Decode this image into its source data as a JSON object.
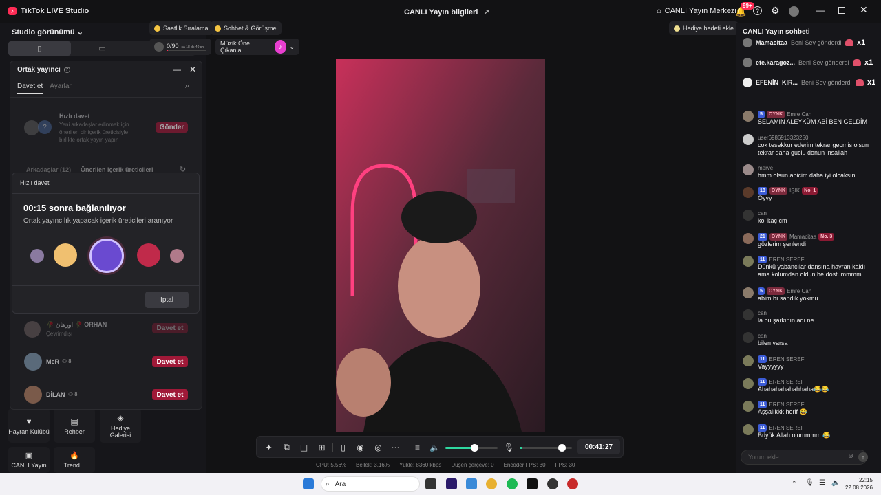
{
  "titlebar": {
    "app_name": "TikTok LIVE Studio",
    "center_title": "CANLI Yayın bilgileri",
    "live_center": "CANLI Yayın Merkezi",
    "notif_badge": "99+"
  },
  "left": {
    "studio_view": "Studio görünümü",
    "chips": {
      "hourly_rank": "Saatlik Sıralama",
      "chat_call": "Sohbet & Görüşme",
      "progress": "0/90",
      "progress_sub": "sa 18 dk 40 sn",
      "music": "Müzik Öne Çıkanla...",
      "gift_goal": "Hediye hedefi ekle"
    },
    "cohost": {
      "title": "Ortak yayıncı",
      "tab_invite": "Davet et",
      "tab_settings": "Ayarlar",
      "quick_invite_title": "Hızlı davet",
      "quick_invite_desc": "Yeni arkadaşlar edinmek için önerilen bir içerik üreticisiyle birlikte ortak yayın yapın",
      "send": "Gönder",
      "friends_tab": "Arkadaşlar (12)",
      "suggested_tab": "Önerilen içerik üreticileri",
      "users": [
        {
          "name": "🥀 اورهان 🥀 ORHAN",
          "status": "Çevrimdışı",
          "count": "",
          "action": "Davet et"
        },
        {
          "name": "MeR",
          "status": "",
          "count": "8",
          "action": "Davet et"
        },
        {
          "name": "DİLAN",
          "status": "",
          "count": "8",
          "action": "Davet et"
        }
      ]
    },
    "modal": {
      "title": "Hızlı davet",
      "countdown": "00:15 sonra bağlanılıyor",
      "subtitle": "Ortak yayıncılık yapacak içerik üreticileri aranıyor",
      "cancel": "İptal"
    },
    "tools": [
      {
        "label": "Hayran Kulübü"
      },
      {
        "label": "Rehber"
      },
      {
        "label": "Hediye Galerisi"
      },
      {
        "label": "CANLI Yayın"
      },
      {
        "label": "Trend..."
      }
    ]
  },
  "controls": {
    "timer": "00:41:27",
    "volume_level": 0.55,
    "mic_level": 0.8
  },
  "stats": {
    "cpu": "CPU:  5.56%",
    "memory": "Bellek:  3.16%",
    "upload": "Yükle:  8360 kbps",
    "dropped": "Düşen çerçeve:  0",
    "encoder_fps": "Encoder FPS:  30",
    "fps": "FPS:  30"
  },
  "chat": {
    "title": "CANLI Yayın sohbeti",
    "gifts": [
      {
        "name": "Mamacitaa",
        "gift": "Beni Sev gönderdi",
        "mult": "x1"
      },
      {
        "name": "efe.karagoz...",
        "gift": "Beni Sev gönderdi",
        "mult": "x1"
      },
      {
        "name": "EFENİN_KIR...",
        "gift": "Beni Sev gönderdi",
        "mult": "x1"
      }
    ],
    "messages": [
      {
        "lvl": "5",
        "fan": "OYNK",
        "user": "Emre Can",
        "rank": "",
        "text": "SELAMIN ALEYKÜM ABİ BEN GELDİM",
        "color": "#8a7a6a"
      },
      {
        "lvl": "",
        "fan": "",
        "user": "user6986913323250",
        "rank": "",
        "text": "cok tesekkur ederim tekrar gecmis olsun tekrar daha guclu donun insallah",
        "color": "#cccccc"
      },
      {
        "lvl": "",
        "fan": "",
        "user": "merve",
        "rank": "",
        "text": "hmm olsun abicim daha iyi olcaksın",
        "color": "#9a8a8a"
      },
      {
        "lvl": "18",
        "fan": "OYNK",
        "user": "IŞIK",
        "rank": "No. 1",
        "text": "Oyyy",
        "color": "#5a3a2a"
      },
      {
        "lvl": "",
        "fan": "",
        "user": "can",
        "rank": "",
        "text": "kol kaç cm",
        "color": "#333333"
      },
      {
        "lvl": "21",
        "fan": "OYNK",
        "user": "Mamacitaa",
        "rank": "No. 3",
        "text": "gözlerim şenlendi",
        "color": "#8a6a5a"
      },
      {
        "lvl": "11",
        "fan": "",
        "user": "EREN SEREF",
        "rank": "",
        "text": "Dünkü yabancılar dansına hayran kaldı ama kolumdan oldun he dostummmm",
        "color": "#7a7a5a"
      },
      {
        "lvl": "5",
        "fan": "OYNK",
        "user": "Emre Can",
        "rank": "",
        "text": "abim bı sandık yokmu",
        "color": "#8a7a6a"
      },
      {
        "lvl": "",
        "fan": "",
        "user": "can",
        "rank": "",
        "text": "la bu şarkının adı ne",
        "color": "#333333"
      },
      {
        "lvl": "",
        "fan": "",
        "user": "can",
        "rank": "",
        "text": "bilen varsa",
        "color": "#333333"
      },
      {
        "lvl": "11",
        "fan": "",
        "user": "EREN SEREF",
        "rank": "",
        "text": "Vayyyyyy",
        "color": "#7a7a5a"
      },
      {
        "lvl": "11",
        "fan": "",
        "user": "EREN SEREF",
        "rank": "",
        "text": "Ahahahahahahhaha😂😂",
        "color": "#7a7a5a"
      },
      {
        "lvl": "11",
        "fan": "",
        "user": "EREN SEREF",
        "rank": "",
        "text": "Aşşalıkkk herif 😂",
        "color": "#7a7a5a"
      },
      {
        "lvl": "11",
        "fan": "",
        "user": "EREN SEREF",
        "rank": "",
        "text": "Büyük Allah olummmm 😂",
        "color": "#7a7a5a"
      }
    ],
    "input_placeholder": "Yorum ekle"
  },
  "taskbar": {
    "search": "Ara",
    "time": "22:15",
    "date": "22.08.2026"
  }
}
